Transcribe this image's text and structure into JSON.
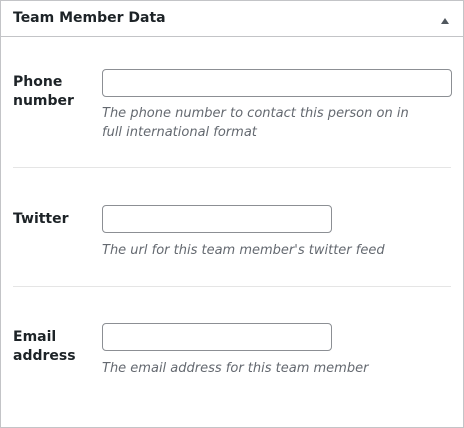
{
  "metabox": {
    "title": "Team Member Data",
    "toggle_icon": "triangle-up-icon"
  },
  "fields": [
    {
      "label": "Phone number",
      "value": "",
      "description": "The phone number to contact this person on in full international format"
    },
    {
      "label": "Twitter",
      "value": "",
      "description": "The url for this team member's twitter feed"
    },
    {
      "label": "Email address",
      "value": "",
      "description": "The email address for this team member"
    }
  ]
}
